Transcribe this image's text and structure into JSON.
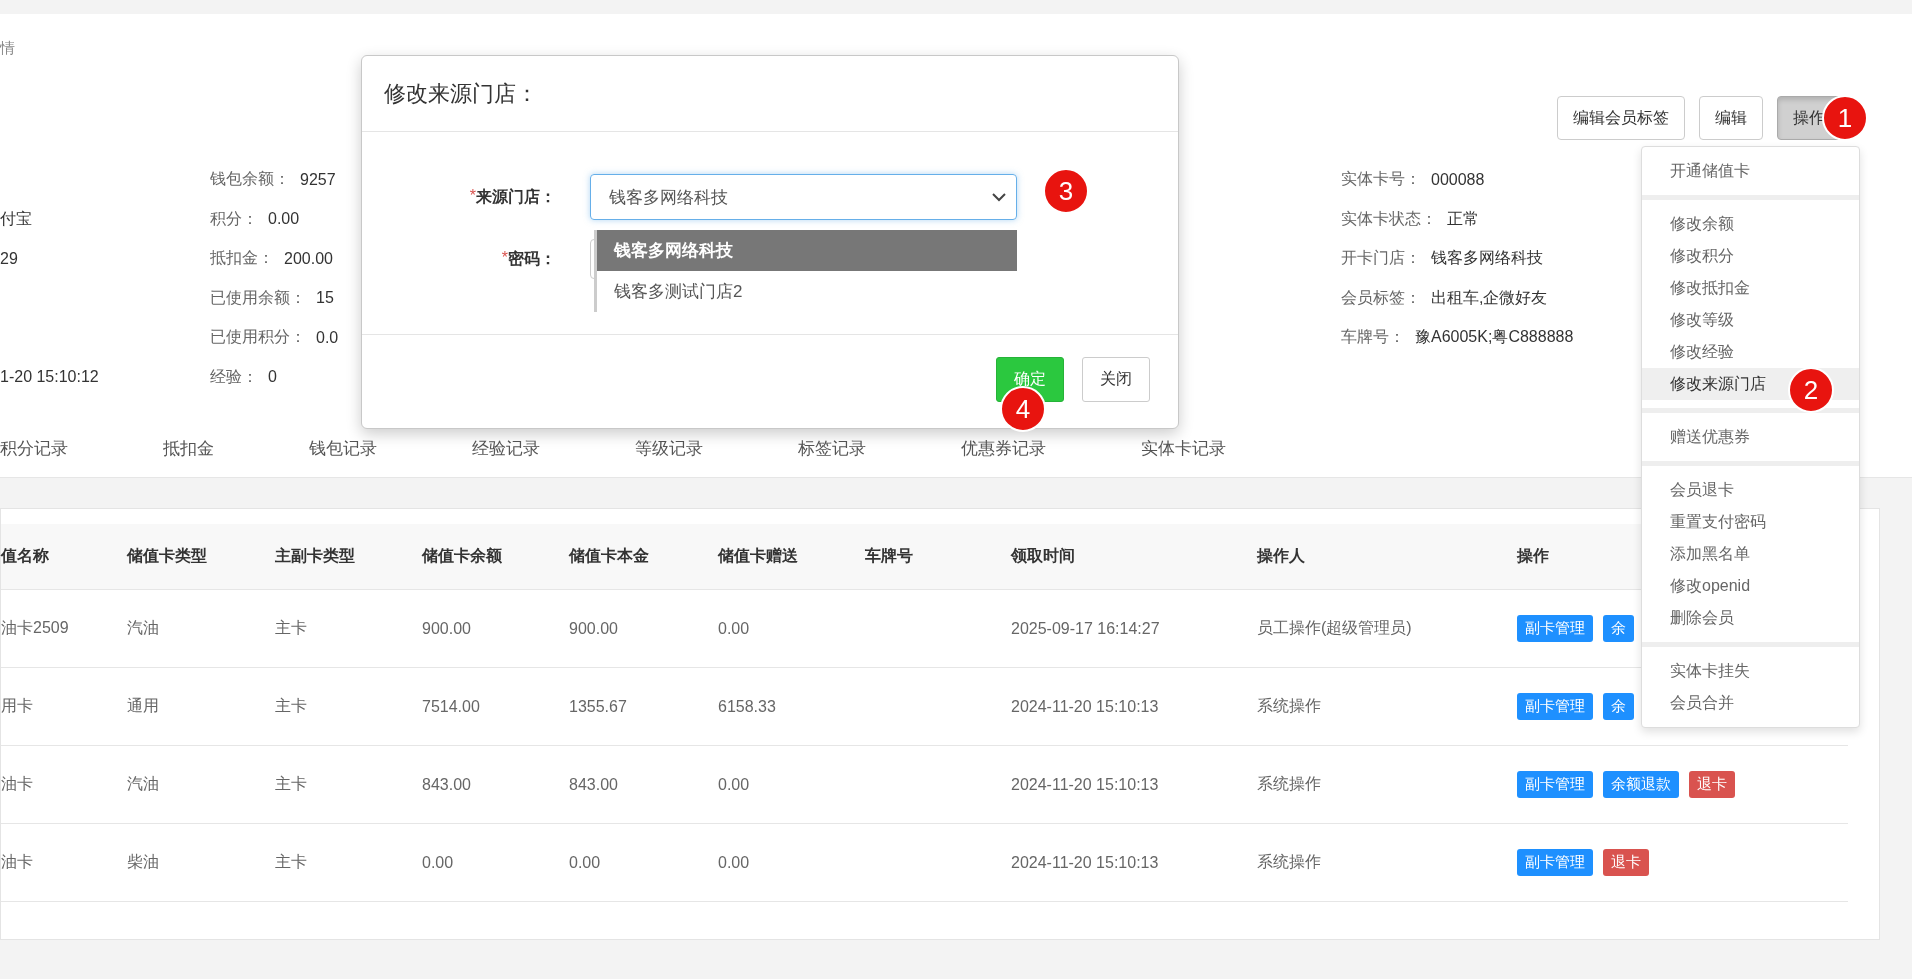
{
  "breadcrumb": "情",
  "header_buttons": [
    {
      "label": "编辑会员标签",
      "pressed": false
    },
    {
      "label": "编辑",
      "pressed": false
    },
    {
      "label": "操作",
      "pressed": true
    }
  ],
  "info_rows": [
    {
      "column_2_label": "钱包余额：",
      "column_2_value": "9257",
      "column_3_label": "实体卡号：",
      "column_3_value": "000088"
    },
    {
      "column_1": "付宝",
      "column_2_label": "积分：",
      "column_2_value": "0.00",
      "column_3_label": "实体卡状态：",
      "column_3_value": "正常"
    },
    {
      "column_1": "29",
      "column_2_label": "抵扣金：",
      "column_2_value": "200.00",
      "column_3_label": "开卡门店：",
      "column_3_value": "钱客多网络科技"
    },
    {
      "column_2_label": "已使用余额：",
      "column_2_value": "15",
      "column_3_label": "会员标签：",
      "column_3_value": "出租车,企微好友"
    },
    {
      "column_2_label": "已使用积分：",
      "column_2_value": "0.0",
      "column_3_label": "车牌号：",
      "column_3_value": "豫A6005K;粤C888888"
    },
    {
      "column_1": "1-20 15:10:12",
      "column_2_label": "经验：",
      "column_2_value": "0"
    }
  ],
  "tabs": [
    "积分记录",
    "抵扣金",
    "钱包记录",
    "经验记录",
    "等级记录",
    "标签记录",
    "优惠券记录",
    "实体卡记录"
  ],
  "table": {
    "columns": [
      "值名称",
      "储值卡类型",
      "主副卡类型",
      "储值卡余额",
      "储值卡本金",
      "储值卡赠送",
      "车牌号",
      "领取时间",
      "操作人",
      "操作"
    ],
    "rows": [
      {
        "name": "油卡2509",
        "card_type": "汽油",
        "main_sub": "主卡",
        "balance": "900.00",
        "principal": "900.00",
        "bonus": "0.00",
        "time": "2025-09-17 16:14:27",
        "operator": "员工操作(超级管理员)",
        "actions": [
          {
            "label": "副卡管理",
            "kind": "primary"
          },
          {
            "label": "余",
            "kind": "primary"
          }
        ]
      },
      {
        "name": "用卡",
        "card_type": "通用",
        "main_sub": "主卡",
        "balance": "7514.00",
        "principal": "1355.67",
        "bonus": "6158.33",
        "time": "2024-11-20 15:10:13",
        "operator": "系统操作",
        "actions": [
          {
            "label": "副卡管理",
            "kind": "primary"
          },
          {
            "label": "余",
            "kind": "primary"
          }
        ]
      },
      {
        "name": "油卡",
        "card_type": "汽油",
        "main_sub": "主卡",
        "balance": "843.00",
        "principal": "843.00",
        "bonus": "0.00",
        "time": "2024-11-20 15:10:13",
        "operator": "系统操作",
        "actions": [
          {
            "label": "副卡管理",
            "kind": "primary"
          },
          {
            "label": "余额退款",
            "kind": "primary"
          },
          {
            "label": "退卡",
            "kind": "danger"
          }
        ]
      },
      {
        "name": "油卡",
        "card_type": "柴油",
        "main_sub": "主卡",
        "balance": "0.00",
        "principal": "0.00",
        "bonus": "0.00",
        "time": "2024-11-20 15:10:13",
        "operator": "系统操作",
        "actions": [
          {
            "label": "副卡管理",
            "kind": "primary"
          },
          {
            "label": "退卡",
            "kind": "danger"
          }
        ]
      }
    ]
  },
  "action_menu": {
    "groups": [
      {
        "items": [
          {
            "label": "开通储值卡",
            "selected": false
          }
        ]
      },
      {
        "items": [
          {
            "label": "修改余额",
            "selected": false
          },
          {
            "label": "修改积分",
            "selected": false
          },
          {
            "label": "修改抵扣金",
            "selected": false
          },
          {
            "label": "修改等级",
            "selected": false
          },
          {
            "label": "修改经验",
            "selected": false
          },
          {
            "label": "修改来源门店",
            "selected": true
          }
        ]
      },
      {
        "items": [
          {
            "label": "赠送优惠券",
            "selected": false
          }
        ]
      },
      {
        "items": [
          {
            "label": "会员退卡",
            "selected": false
          },
          {
            "label": "重置支付密码",
            "selected": false
          },
          {
            "label": "添加黑名单",
            "selected": false
          },
          {
            "label": "修改openid",
            "selected": false
          },
          {
            "label": "删除会员",
            "selected": false
          }
        ]
      },
      {
        "items": [
          {
            "label": "实体卡挂失",
            "selected": false
          },
          {
            "label": "会员合并",
            "selected": false
          }
        ]
      }
    ]
  },
  "modal": {
    "title": "修改来源门店：",
    "fields": [
      {
        "marker": "*",
        "label": "来源门店：",
        "kind": "select",
        "value": "钱客多网络科技"
      },
      {
        "marker": "*",
        "label": "密码：",
        "kind": "password"
      }
    ],
    "dropdown_options": [
      {
        "label": "钱客多网络科技",
        "selected": true
      },
      {
        "label": "钱客多测试门店2",
        "selected": false
      }
    ],
    "buttons": [
      {
        "label": "确定",
        "kind": "primary"
      },
      {
        "label": "关闭",
        "kind": "default"
      }
    ]
  },
  "step_markers": [
    "1",
    "2",
    "3",
    "4"
  ]
}
